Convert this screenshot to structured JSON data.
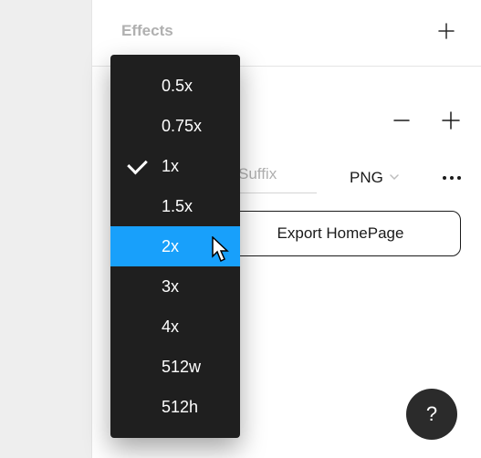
{
  "effects": {
    "title": "Effects"
  },
  "export": {
    "suffix_placeholder": "Suffix",
    "format_label": "PNG",
    "button_label": "Export HomePage"
  },
  "dropdown": {
    "items": [
      {
        "label": "0.5x"
      },
      {
        "label": "0.75x"
      },
      {
        "label": "1x",
        "selected": true
      },
      {
        "label": "1.5x"
      },
      {
        "label": "2x",
        "highlight": true
      },
      {
        "label": "3x"
      },
      {
        "label": "4x"
      },
      {
        "label": "512w"
      },
      {
        "label": "512h"
      }
    ]
  },
  "help": {
    "label": "?"
  }
}
